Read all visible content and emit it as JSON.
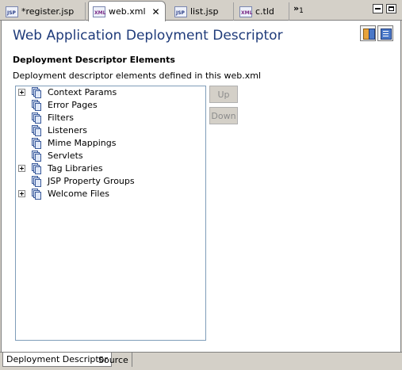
{
  "tabs": [
    {
      "label": "*register.jsp",
      "icon": "jsp-file-icon",
      "icon_text": "JSP",
      "active": false
    },
    {
      "label": "web.xml",
      "icon": "xml-file-icon",
      "icon_text": "XML",
      "active": true
    },
    {
      "label": "list.jsp",
      "icon": "jsp-file-icon",
      "icon_text": "JSP",
      "active": false
    },
    {
      "label": "c.tld",
      "icon": "xml-file-icon",
      "icon_text": "XML",
      "active": false
    }
  ],
  "close_glyph": "✕",
  "overflow": {
    "chevron": "»",
    "count": "1"
  },
  "form": {
    "title": "Web Application Deployment Descriptor",
    "section_title": "Deployment Descriptor Elements",
    "section_description": "Deployment descriptor elements defined in this web.xml"
  },
  "tree": [
    {
      "label": "Context Params",
      "expandable": true
    },
    {
      "label": "Error Pages",
      "expandable": false
    },
    {
      "label": "Filters",
      "expandable": false
    },
    {
      "label": "Listeners",
      "expandable": false
    },
    {
      "label": "Mime Mappings",
      "expandable": false
    },
    {
      "label": "Servlets",
      "expandable": false
    },
    {
      "label": "Tag Libraries",
      "expandable": true
    },
    {
      "label": "JSP Property Groups",
      "expandable": false
    },
    {
      "label": "Welcome Files",
      "expandable": true
    }
  ],
  "buttons": {
    "up": "Up",
    "down": "Down"
  },
  "page_tabs": [
    {
      "label": "Deployment Descriptor",
      "active": true
    },
    {
      "label": "Source",
      "active": false
    }
  ],
  "colors": {
    "title": "#1f3b7a",
    "tree_border": "#7f9db9",
    "disabled_text": "#8c8c8c"
  }
}
